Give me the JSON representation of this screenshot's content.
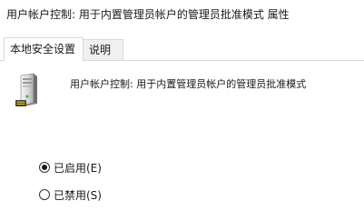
{
  "window": {
    "title": "用户帐户控制: 用于内置管理员帐户的管理员批准模式 属性"
  },
  "tabs": [
    {
      "label": "本地安全设置",
      "selected": true
    },
    {
      "label": "说明",
      "selected": false
    }
  ],
  "policy": {
    "icon": "computer-tower-icon",
    "name": "用户帐户控制: 用于内置管理员帐户的管理员批准模式"
  },
  "options": {
    "enabled_label": "已启用(E)",
    "disabled_label": "已禁用(S)",
    "selected": "enabled"
  }
}
